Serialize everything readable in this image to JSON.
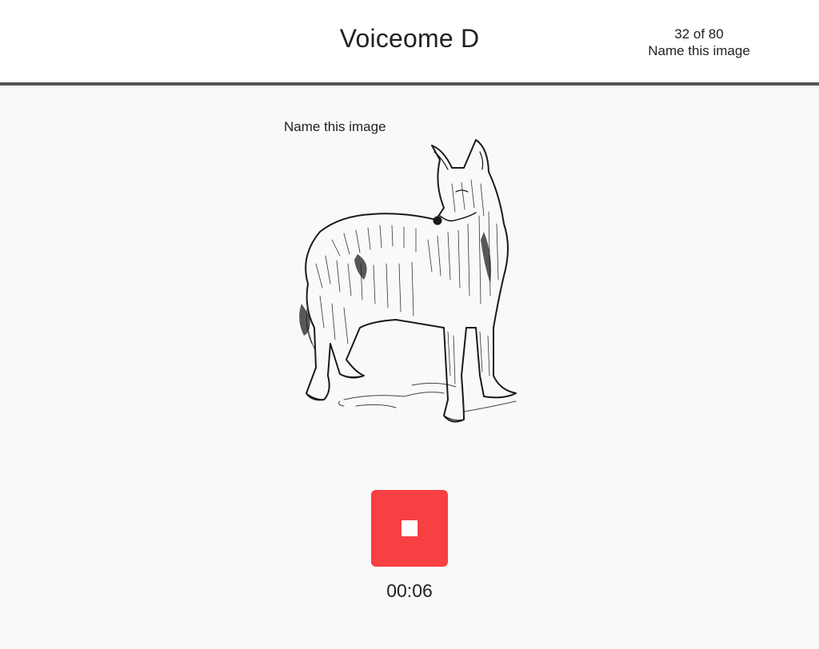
{
  "header": {
    "title": "Voiceome D",
    "progress": "32 of 80",
    "task_name": "Name this image"
  },
  "main": {
    "prompt": "Name this image",
    "image_icon": "wolf-sketch",
    "record": {
      "button_icon": "stop-icon",
      "button_color": "#f83f42",
      "elapsed": "00:06"
    }
  }
}
